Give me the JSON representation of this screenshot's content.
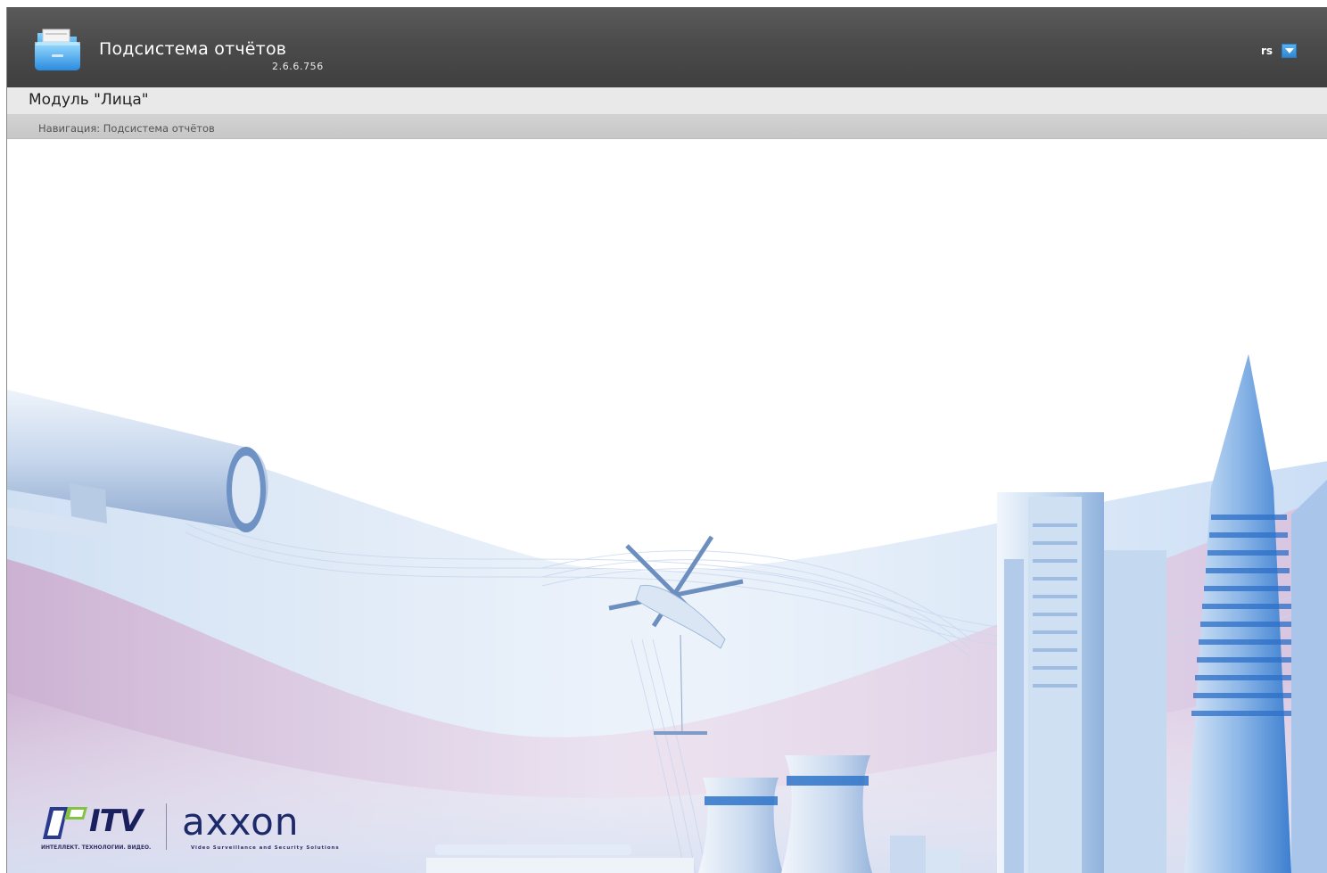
{
  "header": {
    "app_title": "Подсистема отчётов",
    "version": "2.6.6.756",
    "user_name": "rs",
    "accent_color": "#3a96dd"
  },
  "module": {
    "title": "Модуль \"Лица\""
  },
  "breadcrumb": {
    "text": "Навигация: Подсистема отчётов"
  },
  "branding": {
    "itv_logo": "ITV",
    "itv_subtitle": "ИНТЕЛЛЕКТ. ТЕХНОЛОГИИ. ВИДЕО.",
    "axxon_logo": "axxon",
    "axxon_subtitle": "Video Surveillance and Security Solutions"
  },
  "icons": {
    "app_icon": "folder-icon",
    "user_menu_icon": "chevron-down-icon"
  }
}
